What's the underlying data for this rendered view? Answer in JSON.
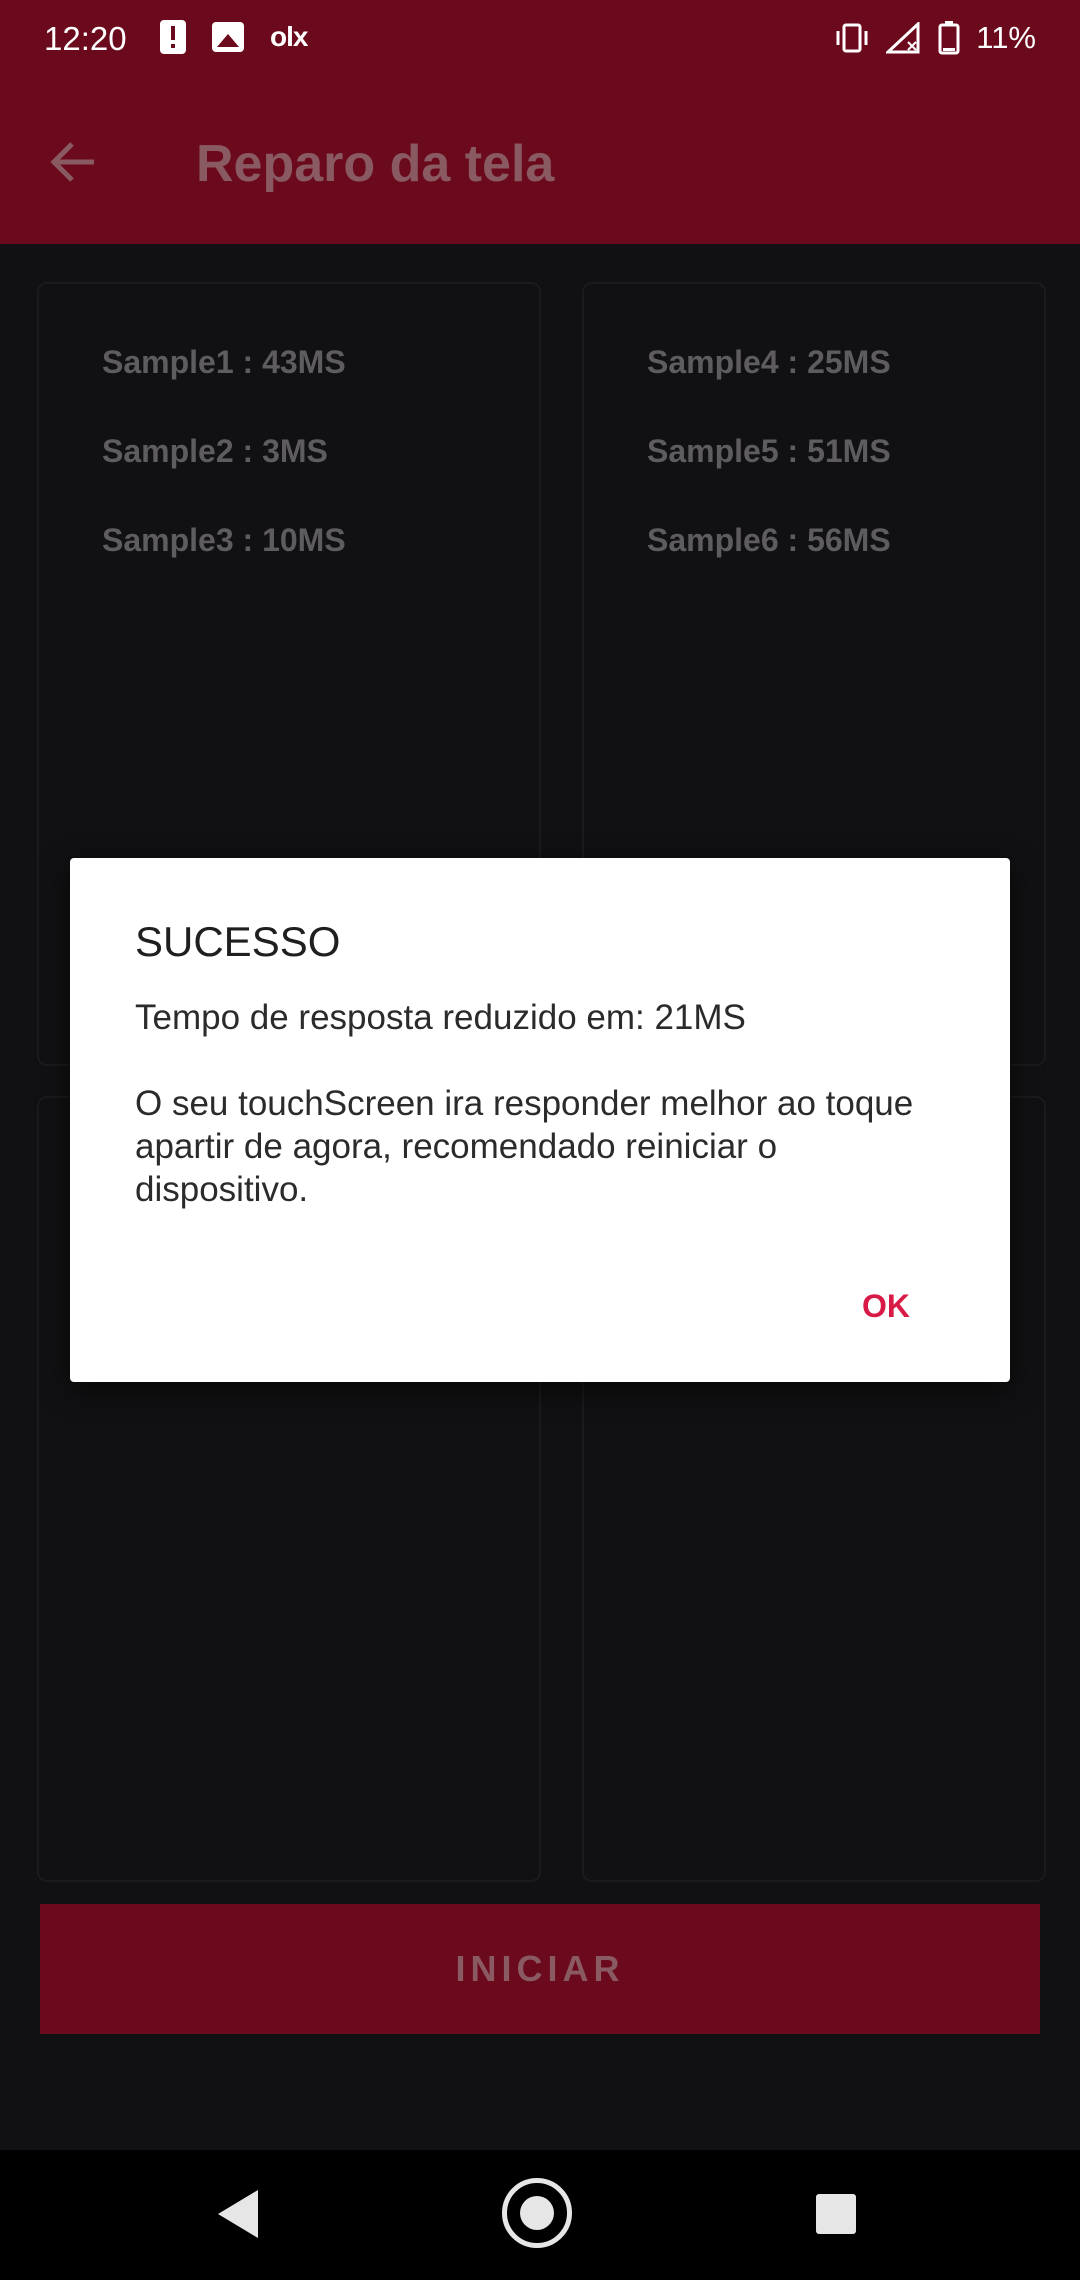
{
  "status_bar": {
    "time": "12:20",
    "notification_icons": [
      "alert-icon",
      "image-icon",
      "olx-icon"
    ],
    "olx_label": "olx",
    "battery": "11%"
  },
  "app_bar": {
    "title": "Reparo da tela"
  },
  "cards": {
    "left": [
      "Sample1 : 43MS",
      "Sample2 : 3MS",
      "Sample3 : 10MS"
    ],
    "right": [
      "Sample4 : 25MS",
      "Sample5 : 51MS",
      "Sample6 : 56MS"
    ]
  },
  "start_button": {
    "label": "INICIAR"
  },
  "dialog": {
    "title": "SUCESSO",
    "line1": "Tempo de resposta reduzido em: 21MS",
    "line2": "O seu touchScreen ira responder melhor ao toque apartir de agora, recomendado reiniciar o dispositivo.",
    "ok_label": "OK"
  },
  "colors": {
    "brand": "#6b0a1c",
    "accent": "#d81b46",
    "background": "#111012"
  }
}
